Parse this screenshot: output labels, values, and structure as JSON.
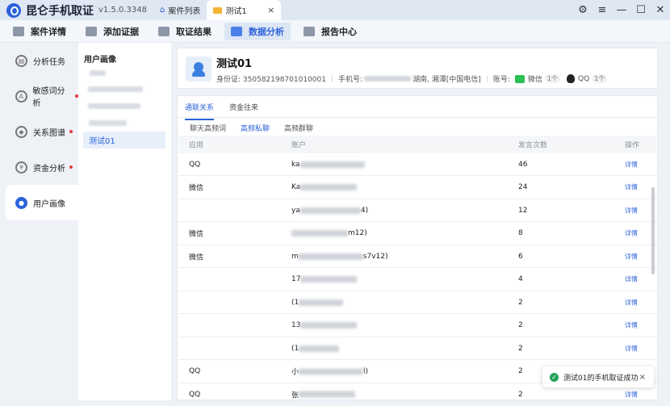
{
  "titlebar": {
    "app_name": "昆仑手机取证",
    "version": "v1.5.0.3348",
    "tabs": [
      {
        "label": "案件列表",
        "icon": "home-icon"
      },
      {
        "label": "测试1",
        "icon": "folder-icon",
        "close": "×"
      }
    ],
    "controls": {
      "settings": "⚙",
      "menu": "≡",
      "minimize": "—",
      "maximize": "☐",
      "close": "✕"
    }
  },
  "toolbar": {
    "items": [
      {
        "label": "案件详情",
        "icon": "case-detail-icon"
      },
      {
        "label": "添加证据",
        "icon": "add-evidence-icon"
      },
      {
        "label": "取证结果",
        "icon": "result-icon"
      },
      {
        "label": "数据分析",
        "icon": "analysis-icon",
        "active": true
      },
      {
        "label": "报告中心",
        "icon": "report-icon"
      }
    ]
  },
  "sidebar": {
    "items": [
      {
        "label": "分析任务",
        "dot": false
      },
      {
        "label": "敏感词分析",
        "dot": true
      },
      {
        "label": "关系图谱",
        "dot": true
      },
      {
        "label": "资金分析",
        "dot": true
      },
      {
        "label": "用户画像",
        "dot": false,
        "active": true
      }
    ]
  },
  "user_panel": {
    "title": "用户画像",
    "selected": "测试01"
  },
  "profile": {
    "name": "测试01",
    "id_label": "身份证: 350582198701010001",
    "phone_label": "手机号:",
    "phone_location": "湖南, 湘潭[中国电信]",
    "account_label": "账号:",
    "wechat": {
      "label": "微信",
      "count": "1个"
    },
    "qq": {
      "label": "QQ",
      "count": "1个"
    }
  },
  "tabs": {
    "primary": [
      "通联关系",
      "资金往来"
    ],
    "secondary": [
      "聊天高频词",
      "高频私聊",
      "高频群聊"
    ]
  },
  "table": {
    "headers": [
      "应用",
      "账户",
      "发言次数",
      "操作"
    ],
    "rows": [
      {
        "app": "QQ",
        "prefix": "ka",
        "suffix": "",
        "count": "46",
        "action": "详情"
      },
      {
        "app": "微信",
        "prefix": "Ka",
        "suffix": "",
        "count": "24",
        "action": "详情"
      },
      {
        "app": "",
        "prefix": "ya",
        "suffix": "4)",
        "count": "12",
        "action": "详情"
      },
      {
        "app": "微信",
        "prefix": "",
        "suffix": "m12)",
        "count": "8",
        "action": "详情"
      },
      {
        "app": "微信",
        "prefix": "m",
        "suffix": "s7v12)",
        "count": "6",
        "action": "详情"
      },
      {
        "app": "",
        "prefix": "17",
        "suffix": "",
        "count": "4",
        "action": "详情"
      },
      {
        "app": "",
        "prefix": "(1",
        "suffix": "",
        "count": "2",
        "action": "详情"
      },
      {
        "app": "",
        "prefix": "13",
        "suffix": "",
        "count": "2",
        "action": "详情"
      },
      {
        "app": "",
        "prefix": "(1",
        "suffix": "",
        "count": "2",
        "action": "详情"
      },
      {
        "app": "QQ",
        "prefix": "小",
        "suffix": "l)",
        "count": "2",
        "action": "详情"
      },
      {
        "app": "QQ",
        "prefix": "张",
        "suffix": "",
        "count": "2",
        "action": "详情"
      }
    ]
  },
  "toast": {
    "message": "测试01的手机取证成功",
    "close": "×"
  }
}
